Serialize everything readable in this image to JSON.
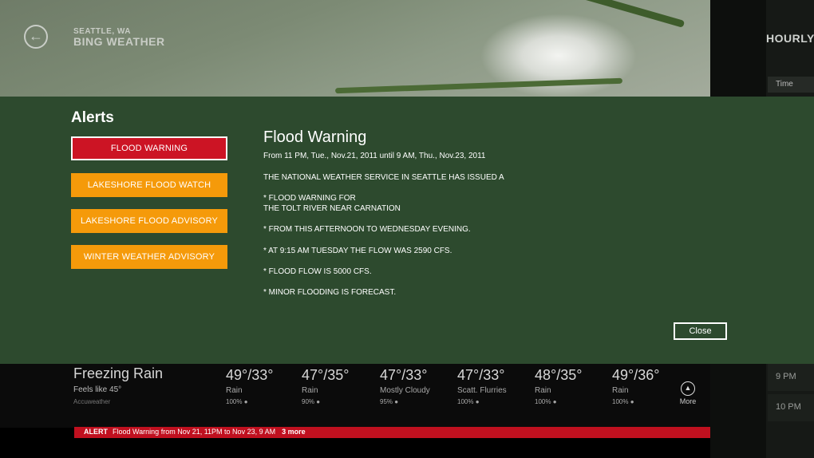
{
  "header": {
    "location": "SEATTLE, WA",
    "app_name": "BING WEATHER",
    "back_icon": "back-arrow-icon"
  },
  "hourly": {
    "title": "HOURLY",
    "time_header": "Time",
    "hours": [
      "9 PM",
      "10 PM"
    ]
  },
  "current": {
    "condition": "Freezing Rain",
    "feels_like": "Feels like 45°",
    "provider": "Accuweather"
  },
  "forecast": [
    {
      "temps": "49°/33°",
      "desc": "Rain",
      "precip": "100%"
    },
    {
      "temps": "47°/35°",
      "desc": "Rain",
      "precip": "90%"
    },
    {
      "temps": "47°/33°",
      "desc": "Mostly Cloudy",
      "precip": "95%"
    },
    {
      "temps": "47°/33°",
      "desc": "Scatt. Flurries",
      "precip": "100%"
    },
    {
      "temps": "48°/35°",
      "desc": "Rain",
      "precip": "100%"
    },
    {
      "temps": "49°/36°",
      "desc": "Rain",
      "precip": "100%"
    }
  ],
  "more_label": "More",
  "alert_bar": {
    "label": "ALERT",
    "text": "Flood Warning from Nov 21, 11PM to Nov 23, 9 AM",
    "more": "3 more"
  },
  "dialog": {
    "title": "Alerts",
    "alerts": [
      {
        "label": "FLOOD WARNING",
        "color": "#cc1424",
        "selected": true
      },
      {
        "label": "LAKESHORE FLOOD WATCH",
        "color": "#f59a0a",
        "selected": false
      },
      {
        "label": "LAKESHORE FLOOD ADVISORY",
        "color": "#f59a0a",
        "selected": false
      },
      {
        "label": "WINTER WEATHER ADVISORY",
        "color": "#f59a0a",
        "selected": false
      }
    ],
    "detail": {
      "title": "Flood Warning",
      "range": "From 11 PM, Tue., Nov.21, 2011 until 9 AM, Thu., Nov.23, 2011",
      "lines": [
        "THE NATIONAL WEATHER SERVICE IN SEATTLE HAS ISSUED A",
        "* FLOOD WARNING FOR",
        "THE TOLT RIVER NEAR CARNATION",
        "* FROM THIS AFTERNOON TO WEDNESDAY EVENING.",
        "* AT 9:15 AM TUESDAY THE FLOW WAS 2590 CFS.",
        "* FLOOD FLOW IS 5000 CFS.",
        "* MINOR FLOODING IS FORECAST."
      ]
    },
    "close_label": "Close"
  },
  "colors": {
    "overlay_bg": "#2d4a2e",
    "warning_red": "#cc1424",
    "advisory_orange": "#f59a0a"
  }
}
